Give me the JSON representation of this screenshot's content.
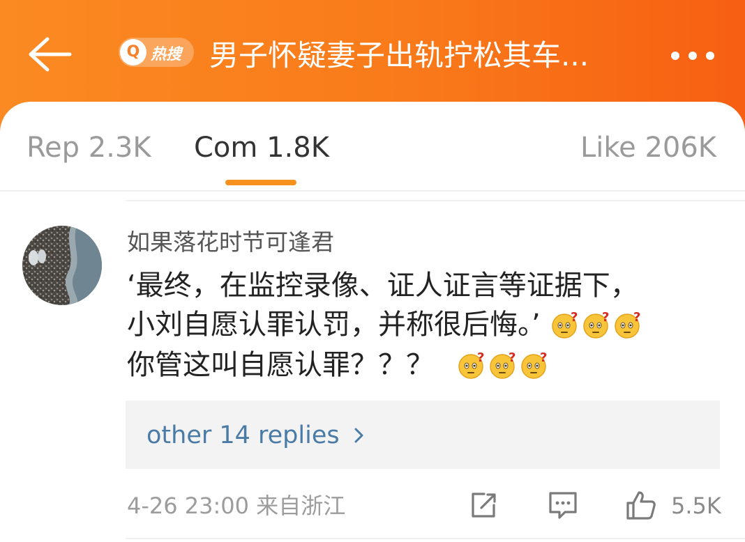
{
  "header": {
    "back_icon": "arrow-left-icon",
    "badge_q": "Q",
    "badge_text": "热搜",
    "title": "男子怀疑妻子出轨拧松其车...",
    "more_icon": "more-dots-icon",
    "accent_color": "#f97a1a"
  },
  "tabs": [
    {
      "label": "Rep 2.3K",
      "active": false
    },
    {
      "label": "Com 1.8K",
      "active": true
    },
    {
      "label": "Like 206K",
      "active": false
    }
  ],
  "comment": {
    "username": "如果落花时节可逢君",
    "lines": [
      "‘最终，在监控录像、证人证言等证据下，",
      "小刘自愿认罪认罚，并称很后悔。’",
      "你管这叫自愿认罪？？？"
    ],
    "emoji_icon": "confused-face-emoji",
    "replies_label": "other 14 replies",
    "time": "4-26 23:00 来自浙江",
    "share_icon": "share-edit-icon",
    "comment_icon": "comment-bubble-icon",
    "like_icon": "thumbs-up-icon",
    "like_count": "5.5K"
  }
}
